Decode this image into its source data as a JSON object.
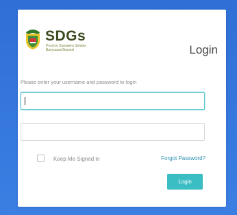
{
  "brand": {
    "name": "SDGs",
    "subtitle": "Provinsi Sumatera Selatan\nBanyuasin/Sumsel"
  },
  "login": {
    "title": "Login",
    "hint": "Please enter your username and password to login",
    "username_value": "",
    "password_value": "",
    "keep_signed_in_label": "Keep Me Signed in",
    "forgot_password_label": "Forgot Password?",
    "submit_label": "Login"
  },
  "colors": {
    "background": "#2f6fd6",
    "accent": "#3bbdc4",
    "link": "#2c8fb0"
  }
}
